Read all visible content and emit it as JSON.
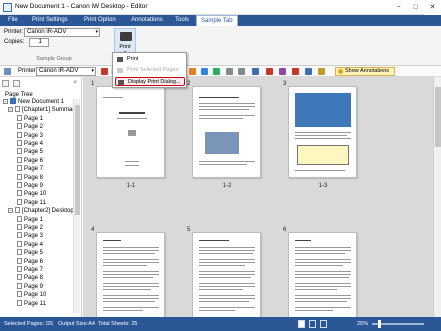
{
  "window": {
    "title": "New Document 1 - Canon iW Desktop - Editor",
    "controls": [
      "−",
      "□",
      "✕"
    ]
  },
  "ribbon_tabs": [
    "File",
    "Print Settings",
    "Print Option",
    "Annotations",
    "Tools",
    "Sample Tab"
  ],
  "ribbon": {
    "printer_label": "Printer:",
    "printer_value": "Canon iR-ADV",
    "copies_label": "Copies:",
    "copies_value": "1",
    "group_label": "Sample Group",
    "print_button_label": "Print"
  },
  "print_menu": {
    "items": [
      {
        "label": "Print",
        "icon": "printer-icon",
        "enabled": true
      },
      {
        "label": "Print Selected Pages",
        "icon": "printer-icon",
        "enabled": false
      },
      {
        "label": "Display Print Dialog...",
        "icon": "print-dialog-icon",
        "enabled": true,
        "highlighted": true
      }
    ]
  },
  "toolbar": {
    "printer_label": "Printer",
    "printer_value": "Canon iR-ADV",
    "show_annotations_label": "Show Annotations"
  },
  "sidebar": {
    "title": "Page Tree",
    "close": "×",
    "tree": [
      {
        "label": "New Document 1",
        "level": 0,
        "type": "doc"
      },
      {
        "label": "[Chapter1] Summary",
        "level": 1,
        "type": "chapter"
      },
      {
        "label": "Page 1",
        "level": 2,
        "type": "page"
      },
      {
        "label": "Page 2",
        "level": 2,
        "type": "page"
      },
      {
        "label": "Page 3",
        "level": 2,
        "type": "page"
      },
      {
        "label": "Page 4",
        "level": 2,
        "type": "page"
      },
      {
        "label": "Page 5",
        "level": 2,
        "type": "page"
      },
      {
        "label": "Page 6",
        "level": 2,
        "type": "page"
      },
      {
        "label": "Page 7",
        "level": 2,
        "type": "page"
      },
      {
        "label": "Page 8",
        "level": 2,
        "type": "page"
      },
      {
        "label": "Page 9",
        "level": 2,
        "type": "page"
      },
      {
        "label": "Page 10",
        "level": 2,
        "type": "page"
      },
      {
        "label": "Page 11",
        "level": 2,
        "type": "page"
      },
      {
        "label": "[Chapter2] Desktop",
        "level": 1,
        "type": "chapter"
      },
      {
        "label": "Page 1",
        "level": 2,
        "type": "page"
      },
      {
        "label": "Page 2",
        "level": 2,
        "type": "page"
      },
      {
        "label": "Page 3",
        "level": 2,
        "type": "page"
      },
      {
        "label": "Page 4",
        "level": 2,
        "type": "page"
      },
      {
        "label": "Page 5",
        "level": 2,
        "type": "page"
      },
      {
        "label": "Page 6",
        "level": 2,
        "type": "page"
      },
      {
        "label": "Page 7",
        "level": 2,
        "type": "page"
      },
      {
        "label": "Page 8",
        "level": 2,
        "type": "page"
      },
      {
        "label": "Page 9",
        "level": 2,
        "type": "page"
      },
      {
        "label": "Page 10",
        "level": 2,
        "type": "page"
      },
      {
        "label": "Page 11",
        "level": 2,
        "type": "page"
      }
    ]
  },
  "pages": [
    {
      "number": "1",
      "caption": "1-1"
    },
    {
      "number": "2",
      "caption": "1-2"
    },
    {
      "number": "3",
      "caption": "1-3"
    },
    {
      "number": "4",
      "caption": ""
    },
    {
      "number": "5",
      "caption": ""
    },
    {
      "number": "6",
      "caption": ""
    }
  ],
  "status": {
    "selected_pages": "Selected Pages: /25",
    "output_size": "Output Size:A4",
    "total_sheets": "Total Sheets: 25",
    "zoom": "25%"
  },
  "colors": {
    "accent": "#2b5797",
    "highlight_border": "#d0021b",
    "annotation_bg": "#fff2b8"
  }
}
